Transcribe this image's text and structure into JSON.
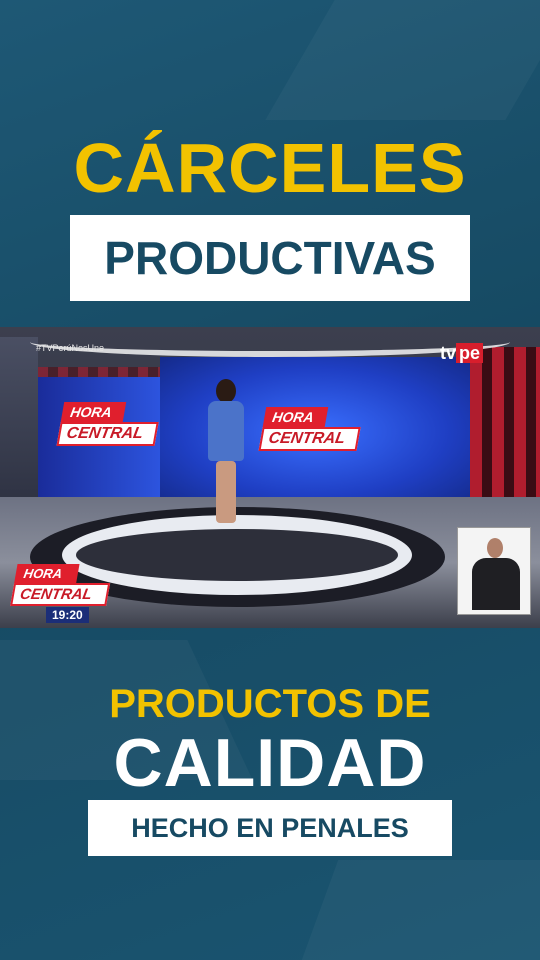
{
  "headline": {
    "line1": "CÁRCELES",
    "line2": "PRODUCTIVAS"
  },
  "video": {
    "hashtag": "#TVPerúNosUne",
    "channel_logo_prefix": "tv",
    "channel_logo_suffix": "pe",
    "show_logo_top": "HORA",
    "show_logo_bottom": "CENTRAL",
    "timestamp": "19:20"
  },
  "footer": {
    "line1": "PRODUCTOS DE",
    "line2": "CALIDAD",
    "line3": "HECHO EN PENALES"
  },
  "colors": {
    "background": "#1a5470",
    "accent_yellow": "#f2c200",
    "text_dark_blue": "#174a63",
    "show_red": "#e01f2d"
  }
}
